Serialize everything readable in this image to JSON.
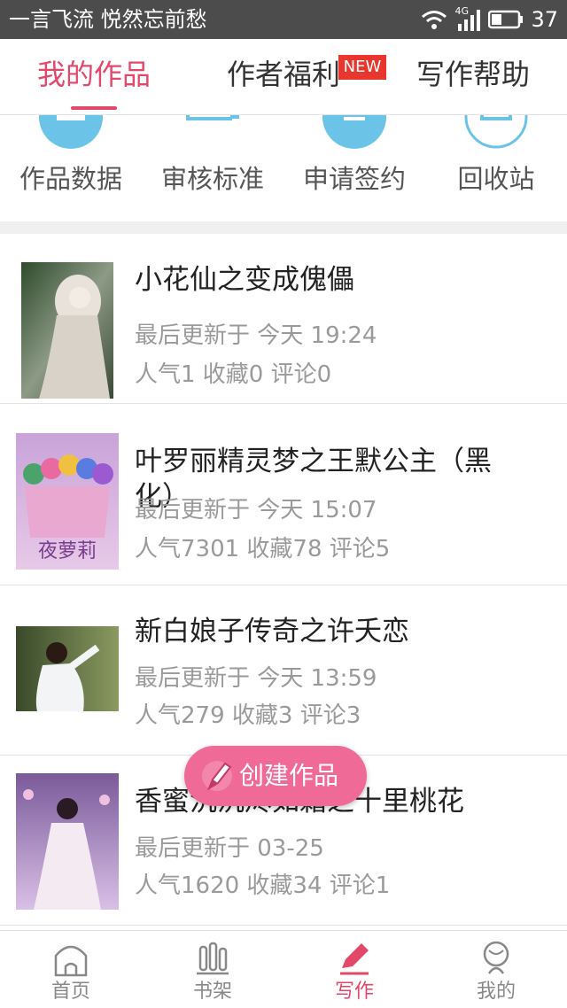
{
  "status_bar": {
    "title": "一言飞流 悦然忘前愁",
    "network": "4G",
    "battery": "37"
  },
  "tabs": [
    {
      "label": "我的作品",
      "active": true
    },
    {
      "label": "作者福利",
      "badge": "NEW",
      "active": false
    },
    {
      "label": "写作帮助",
      "active": false
    }
  ],
  "quick_actions": [
    {
      "label": "作品数据",
      "icon": "bar-chart-icon"
    },
    {
      "label": "审核标准",
      "icon": "review-standard-icon"
    },
    {
      "label": "申请签约",
      "icon": "contract-sign-icon"
    },
    {
      "label": "回收站",
      "icon": "recycle-bin-icon"
    }
  ],
  "works": [
    {
      "title": "小花仙之变成傀儡",
      "updated": "最后更新于 今天 19:24",
      "stats": "人气1 收藏0 评论0"
    },
    {
      "title": "叶罗丽精灵梦之王默公主（黑化）",
      "updated": "最后更新于 今天 15:07",
      "stats": "人气7301 收藏78 评论5",
      "cover_text": "夜萝莉"
    },
    {
      "title": "新白娘子传奇之许夭恋",
      "updated": "最后更新于 今天 13:59",
      "stats": "人气279 收藏3 评论3"
    },
    {
      "title": "香蜜沉沉烬如霜之十里桃花",
      "updated": "最后更新于 03-25",
      "stats": "人气1620 收藏34 评论1"
    }
  ],
  "create_button": {
    "label": "创建作品"
  },
  "bottom_nav": [
    {
      "label": "首页",
      "icon": "home-icon",
      "active": false
    },
    {
      "label": "书架",
      "icon": "bookshelf-icon",
      "active": false
    },
    {
      "label": "写作",
      "icon": "pen-icon",
      "active": true
    },
    {
      "label": "我的",
      "icon": "user-icon",
      "active": false
    }
  ],
  "colors": {
    "accent": "#e3476a",
    "create_button": "#f06a97",
    "quick_icon": "#6cc3e8",
    "new_badge": "#e8362f",
    "status_bar": "#4c4c4c"
  }
}
